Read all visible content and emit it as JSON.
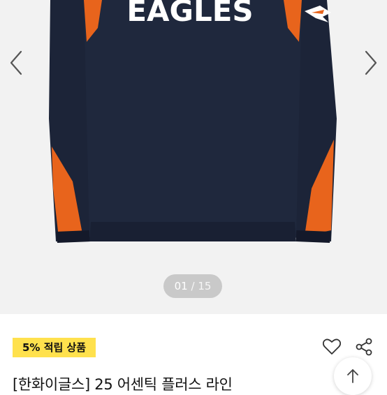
{
  "gallery": {
    "current": "01",
    "separator": "/",
    "total": "15",
    "jersey_text": "EAGLES"
  },
  "product": {
    "badge": "5% 적립 상품",
    "title": "[한화이글스] 25 어센틱 플러스 라인"
  },
  "icons": {
    "prev": "chevron-left-icon",
    "next": "chevron-right-icon",
    "wishlist": "heart-icon",
    "share": "share-icon",
    "scroll_top": "arrow-up-icon"
  },
  "colors": {
    "navy": "#1c2438",
    "orange": "#e8641c",
    "badge": "#ffe14d",
    "counter_bg": "#c9c9c9"
  }
}
